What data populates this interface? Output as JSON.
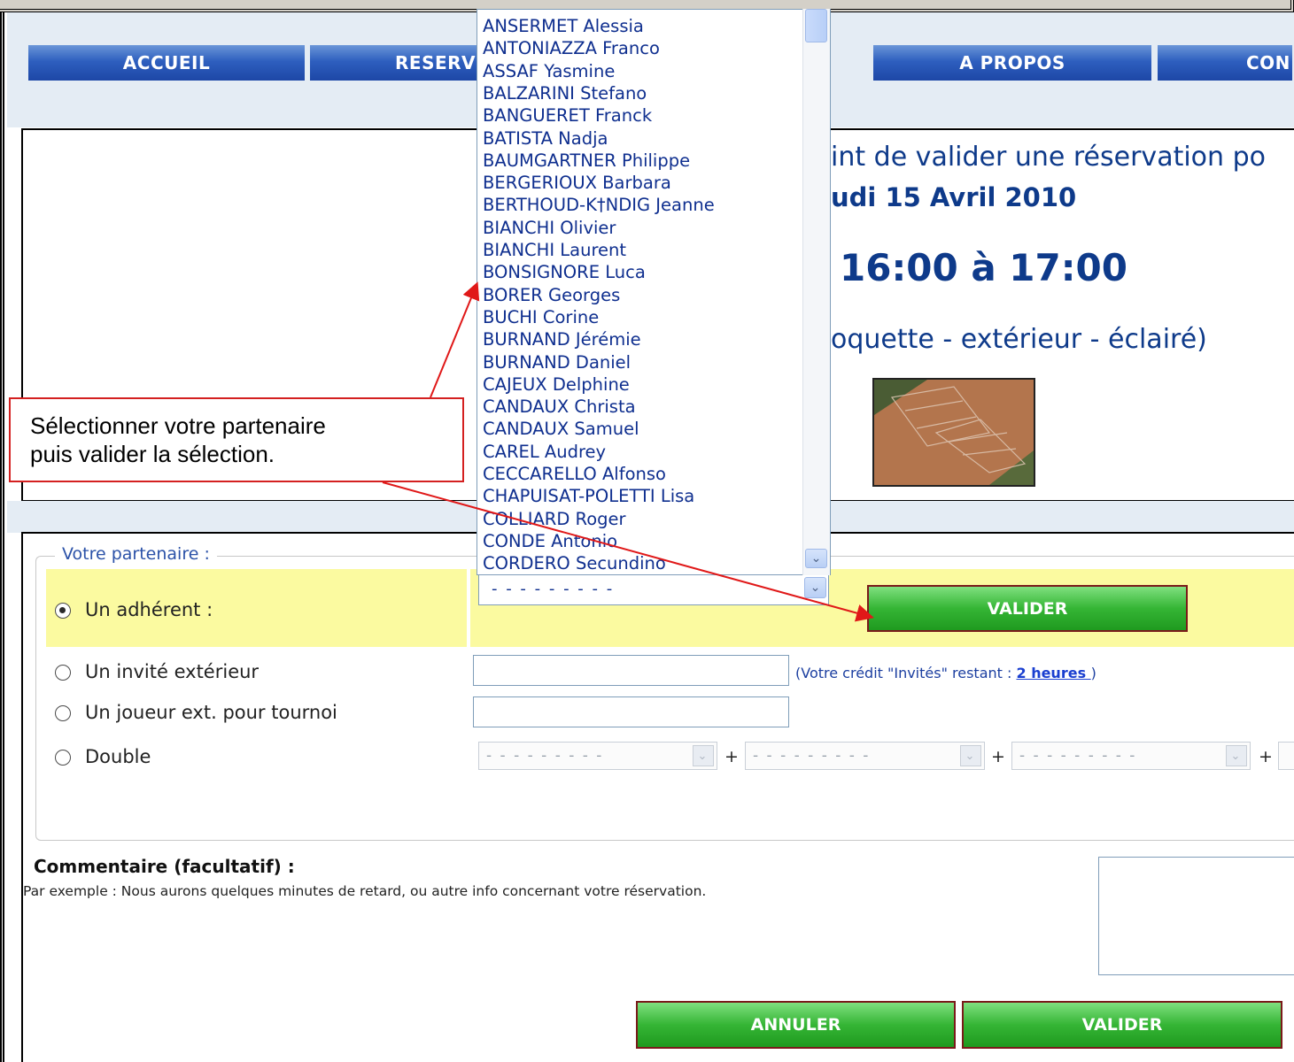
{
  "nav": {
    "items": [
      {
        "label": "ACCUEIL"
      },
      {
        "label": "RESERV"
      },
      {
        "label": "A PROPOS"
      },
      {
        "label": "CON"
      }
    ]
  },
  "info": {
    "line1": "int de valider une réservation po",
    "line2": "udi 15 Avril 2010",
    "time": "16:00 à 17:00",
    "court": "oquette - extérieur - éclairé)"
  },
  "dropdown": {
    "options": [
      "ANSERMET Alessia",
      "ANTONIAZZA Franco",
      "ASSAF Yasmine",
      "BALZARINI Stefano",
      "BANGUERET Franck",
      "BATISTA Nadja",
      "BAUMGARTNER Philippe",
      "BERGERIOUX Barbara",
      "BERTHOUD-K†NDIG Jeanne",
      "BIANCHI Olivier",
      "BIANCHI Laurent",
      "BONSIGNORE Luca",
      "BORER Georges",
      "BUCHI Corine",
      "BURNAND Jérémie",
      "BURNAND Daniel",
      "CAJEUX Delphine",
      "CANDAUX Christa",
      "CANDAUX Samuel",
      "CAREL Audrey",
      "CECCARELLO Alfonso",
      "CHAPUISAT-POLETTI Lisa",
      "COLLIARD Roger",
      "CONDE Antonio",
      "CORDERO Secundino"
    ],
    "selected": "- - - - - - - - -"
  },
  "callout": {
    "line1": "Sélectionner votre partenaire",
    "line2": "puis valider la sélection."
  },
  "partner": {
    "legend": "Votre partenaire :",
    "member_label": "Un adhérent :",
    "guest_label": "Un invité extérieur",
    "tournament_label": "Un joueur ext. pour tournoi",
    "double_label": "Double",
    "validate_label": "VALIDER",
    "credit_prefix": "(Votre crédit \"Invités\" restant : ",
    "credit_value": "2 heures ",
    "credit_suffix": ")",
    "double_placeholder": "- - - - - - - - -",
    "plus": "+"
  },
  "comment": {
    "title": "Commentaire (facultatif) :",
    "hint": "Par exemple : Nous aurons quelques minutes de retard, ou autre info concernant votre réservation."
  },
  "actions": {
    "cancel_label": "ANNULER",
    "validate_label": "VALIDER"
  },
  "colors": {
    "nav_blue": "#2e5fbf",
    "green": "#35b535",
    "link_blue": "#0f2f8f",
    "highlight_yellow": "#fbfaa0",
    "callout_red": "#d42020"
  }
}
